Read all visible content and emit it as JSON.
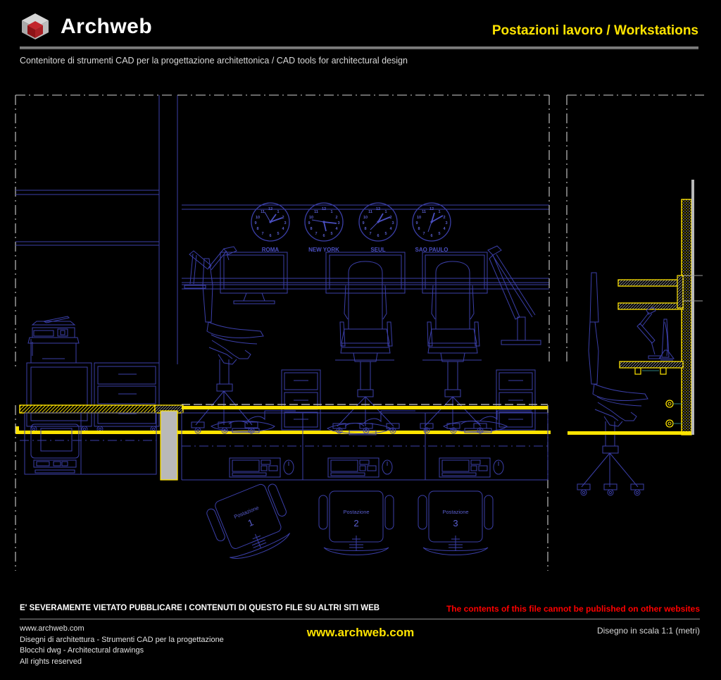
{
  "header": {
    "brand": "Archweb",
    "logo_icon": "cube-logo-icon",
    "title": "Postazioni lavoro  /  Workstations",
    "subtitle": "Contenitore di strumenti CAD per la progettazione architettonica  /  CAD tools for architectural design",
    "accent_yellow": "#ffe400",
    "logo_outer_color": "#c9c9c9",
    "logo_inner_color": "#a81f24"
  },
  "drawing": {
    "line_color": "#3b3fa8",
    "wall_color": "#ffe400",
    "panel_color": "#b3b3b3",
    "background": "#000000",
    "clocks": [
      {
        "city": "ROMA",
        "hour_deg": 40,
        "minute_deg": 75,
        "second_deg": 55
      },
      {
        "city": "NEW YORK",
        "hour_deg": 200,
        "minute_deg": 100,
        "second_deg": 260
      },
      {
        "city": "SEUL",
        "hour_deg": 30,
        "minute_deg": 70,
        "second_deg": 215
      },
      {
        "city": "SAO PAULO",
        "hour_deg": 20,
        "minute_deg": 60,
        "second_deg": 185
      }
    ],
    "clock_numerals": [
      "12",
      "1",
      "2",
      "3",
      "4",
      "5",
      "6",
      "7",
      "8",
      "9",
      "10",
      "11"
    ],
    "workstations": [
      {
        "label": "Postazione",
        "number": "1"
      },
      {
        "label": "Postazione",
        "number": "2"
      },
      {
        "label": "Postazione",
        "number": "3"
      }
    ]
  },
  "footer": {
    "warning_it": "E' SEVERAMENTE VIETATO PUBBLICARE I CONTENUTI DI QUESTO FILE SU ALTRI SITI WEB",
    "warning_en": "The contents of this file cannot be published on other websites",
    "info_lines": [
      "www.archweb.com",
      "Disegni di architettura - Strumenti CAD  per la progettazione",
      "Blocchi dwg - Architectural drawings",
      "All rights reserved"
    ],
    "site_url": "www.archweb.com",
    "scale_note": "Disegno in scala 1:1 (metri)"
  }
}
